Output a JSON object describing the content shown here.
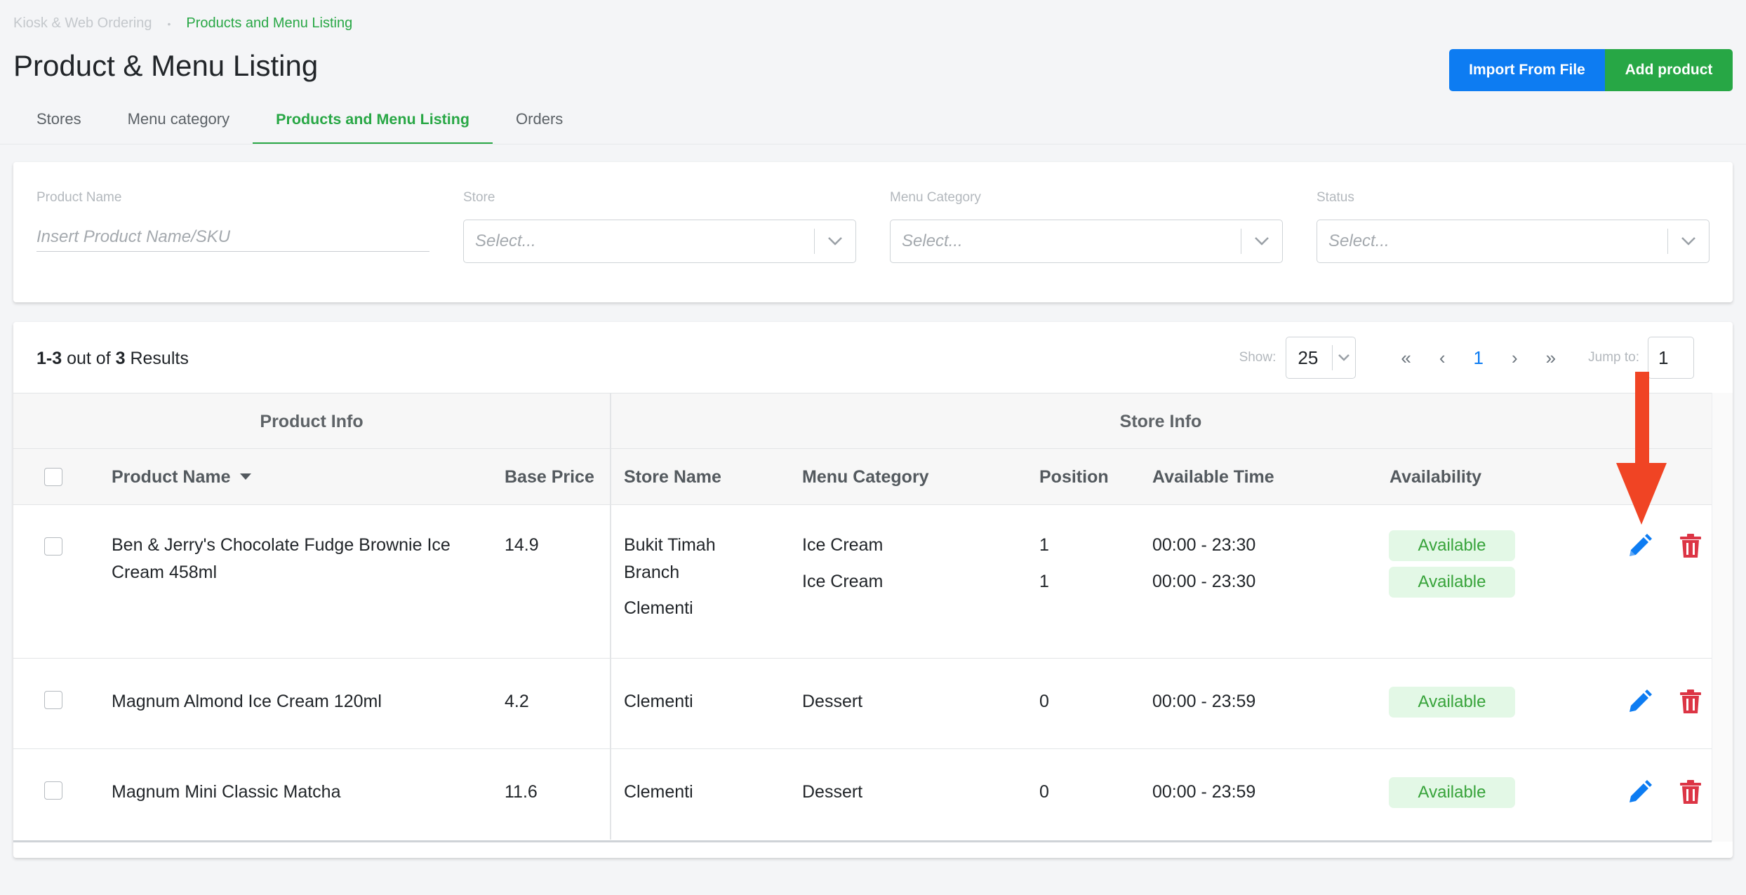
{
  "breadcrumb": {
    "root": "Kiosk & Web Ordering",
    "separator": "•",
    "current": "Products and Menu Listing"
  },
  "page_title": "Product & Menu Listing",
  "actions": {
    "import_label": "Import From File",
    "add_label": "Add product"
  },
  "tabs": [
    {
      "label": "Stores",
      "active": false
    },
    {
      "label": "Menu category",
      "active": false
    },
    {
      "label": "Products and Menu Listing",
      "active": true
    },
    {
      "label": "Orders",
      "active": false
    }
  ],
  "filters": {
    "product_name": {
      "label": "Product Name",
      "placeholder": "Insert Product Name/SKU"
    },
    "store": {
      "label": "Store",
      "placeholder": "Select..."
    },
    "menu_category": {
      "label": "Menu Category",
      "placeholder": "Select..."
    },
    "status": {
      "label": "Status",
      "placeholder": "Select..."
    }
  },
  "results": {
    "range": "1-3",
    "out_of": "out of",
    "total": "3",
    "suffix": "Results"
  },
  "pagination": {
    "show_label": "Show:",
    "show_value": "25",
    "first": "«",
    "prev": "‹",
    "page": "1",
    "next": "›",
    "last": "»",
    "jump_label": "Jump to:",
    "jump_value": "1"
  },
  "table": {
    "groups": {
      "product_info": "Product Info",
      "store_info": "Store Info"
    },
    "columns": {
      "product_name": "Product Name",
      "base_price": "Base Price",
      "store_name": "Store Name",
      "menu_category": "Menu Category",
      "position": "Position",
      "available_time": "Available Time",
      "availability": "Availability"
    },
    "rows": [
      {
        "product_name_line1": "Ben & Jerry's Chocolate Fudge Brownie Ice",
        "product_name_line2": "Cream 458ml",
        "base_price": "14.9",
        "stores": [
          {
            "store_line1": "Bukit Timah",
            "store_line2": "Branch",
            "menu_category": "Ice Cream",
            "position": "1",
            "available_time": "00:00 - 23:30",
            "availability": "Available"
          },
          {
            "store_line1": "Clementi",
            "store_line2": "",
            "menu_category": "Ice Cream",
            "position": "1",
            "available_time": "00:00 - 23:30",
            "availability": "Available"
          }
        ]
      },
      {
        "product_name_line1": "Magnum Almond Ice Cream 120ml",
        "base_price": "4.2",
        "stores": [
          {
            "store_line1": "Clementi",
            "menu_category": "Dessert",
            "position": "0",
            "available_time": "00:00 - 23:59",
            "availability": "Available"
          }
        ]
      },
      {
        "product_name_line1": "Magnum Mini Classic Matcha",
        "base_price": "11.6",
        "stores": [
          {
            "store_line1": "Clementi",
            "menu_category": "Dessert",
            "position": "0",
            "available_time": "00:00 - 23:59",
            "availability": "Available"
          }
        ]
      }
    ]
  },
  "colors": {
    "primary_blue": "#0d7cf2",
    "success_green": "#27a745",
    "danger_red": "#dc3545",
    "annotation_arrow": "#f04424",
    "badge_bg": "#e3f8e6"
  },
  "icons": {
    "edit": "pencil-icon",
    "delete": "trash-icon",
    "sort": "caret-down-icon",
    "chevron": "chevron-down-icon",
    "annotation": "red-arrow-down"
  }
}
